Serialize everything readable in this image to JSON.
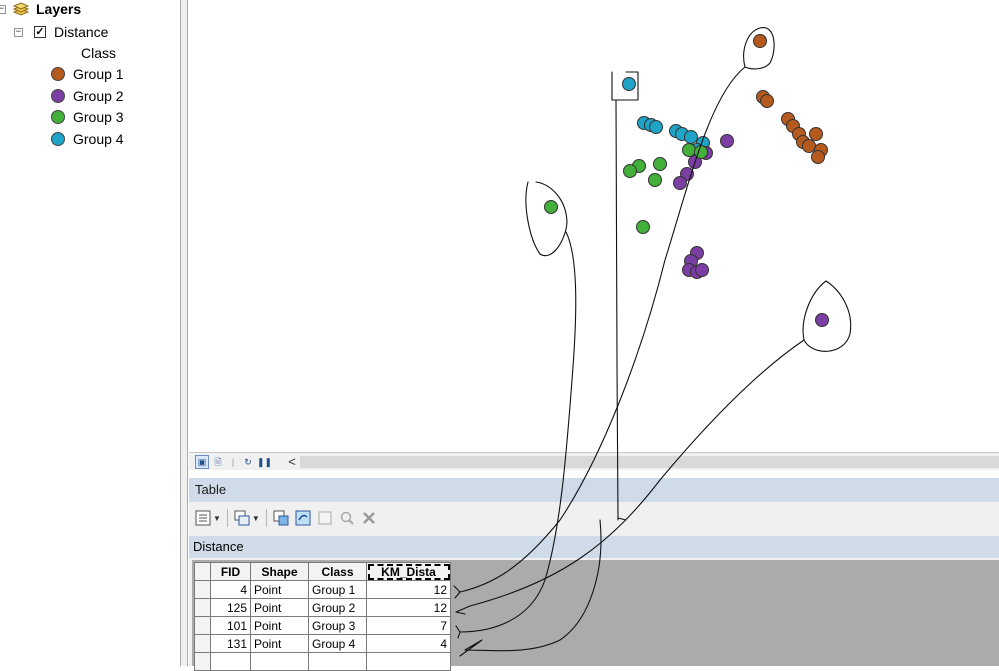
{
  "toc": {
    "root_label": "Layers",
    "layer_label": "Distance",
    "layer_checked": true,
    "field_label": "Class",
    "classes": [
      {
        "label": "Group 1",
        "color": "#b55a1e"
      },
      {
        "label": "Group 2",
        "color": "#7b3ea3"
      },
      {
        "label": "Group 3",
        "color": "#44b03c"
      },
      {
        "label": "Group 4",
        "color": "#1fa3c6"
      }
    ]
  },
  "table_window": {
    "title": "Table",
    "tab_label": "Distance",
    "toolbar_icons": [
      "table-options-icon",
      "related-tables-icon",
      "select-by-attributes-icon",
      "switch-selection-icon",
      "clear-selection-icon",
      "zoom-to-selected-icon",
      "delete-selected-icon"
    ],
    "columns": [
      "FID",
      "Shape",
      "Class",
      "KM_Dista"
    ],
    "rows": [
      {
        "fid": "4",
        "shape": "Point",
        "class": "Group 1",
        "km": "12"
      },
      {
        "fid": "125",
        "shape": "Point",
        "class": "Group 2",
        "km": "12"
      },
      {
        "fid": "101",
        "shape": "Point",
        "class": "Group 3",
        "km": "7"
      },
      {
        "fid": "131",
        "shape": "Point",
        "class": "Group 4",
        "km": "4"
      }
    ]
  },
  "status_bar": {
    "scroll_left_glyph": "<",
    "icons": [
      "data-view-icon",
      "layout-view-icon",
      "refresh-icon",
      "pause-icon"
    ]
  }
}
